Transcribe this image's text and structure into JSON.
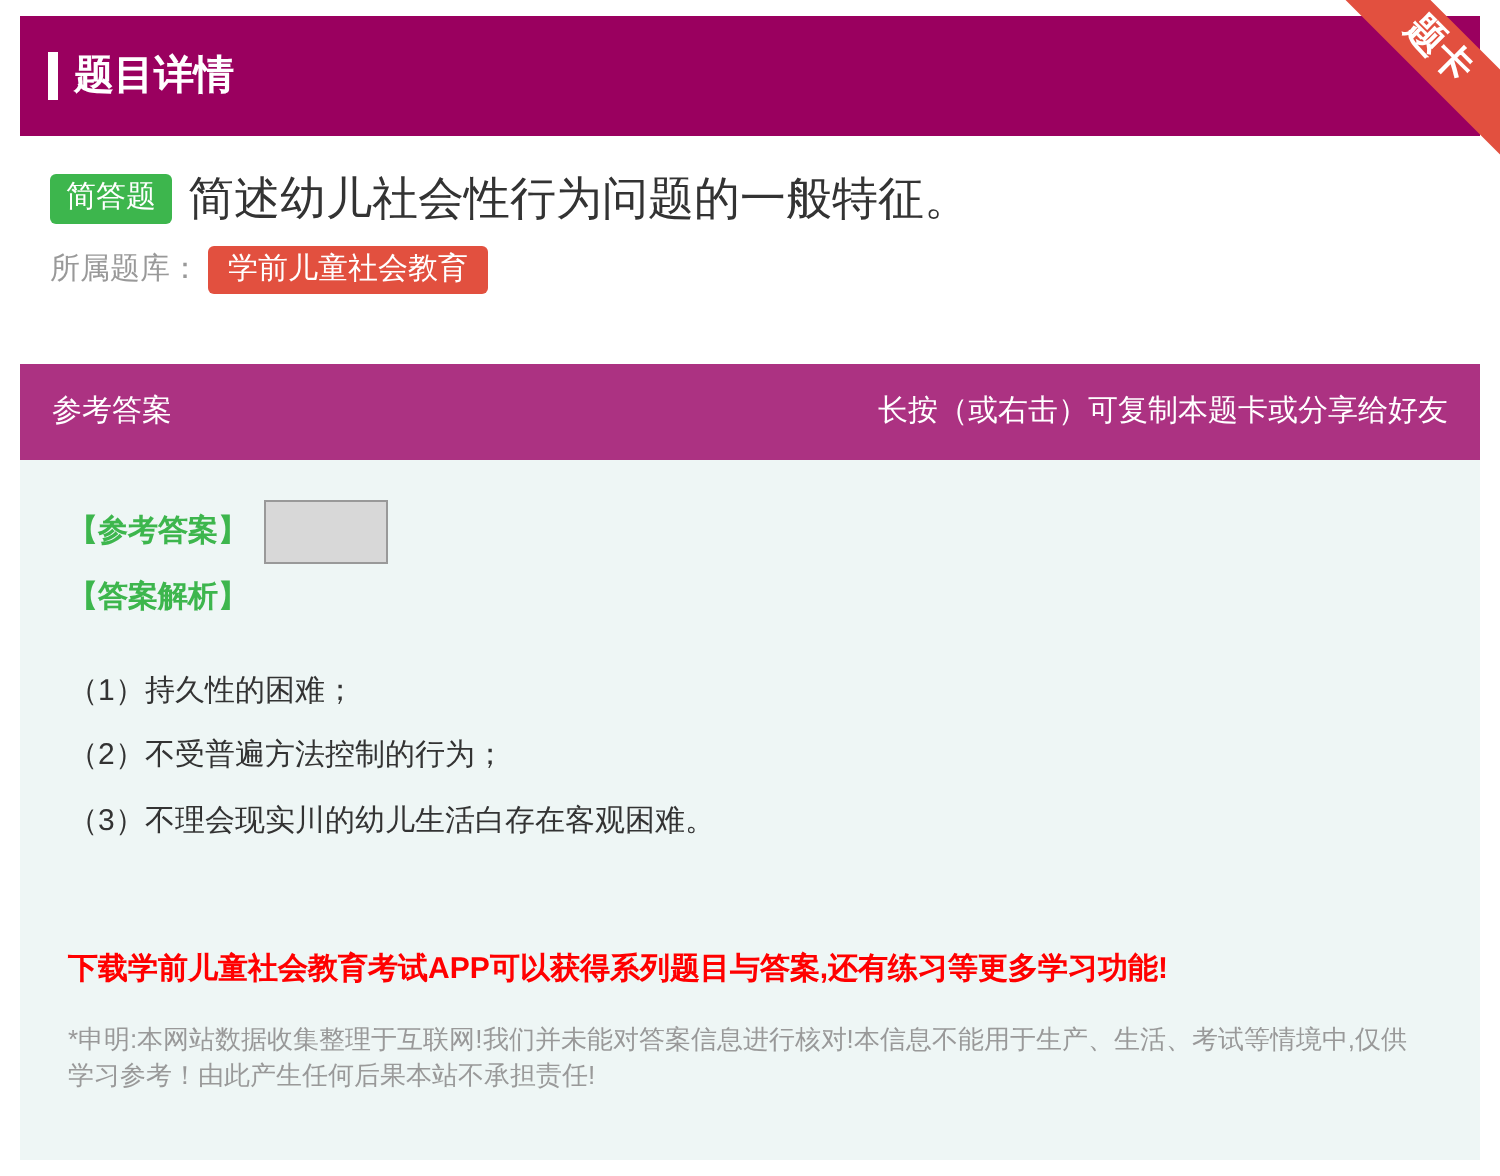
{
  "header": {
    "title": "题目详情",
    "ribbon": "题卡"
  },
  "question": {
    "type_badge": "简答题",
    "text": "简述幼儿社会性行为问题的一般特征。",
    "bank_label": "所属题库：",
    "bank": "学前儿童社会教育"
  },
  "answer_panel": {
    "title": "参考答案",
    "hint": "长按（或右击）可复制本题卡或分享给好友"
  },
  "answer": {
    "answer_label": "【参考答案】",
    "analysis_label": "【答案解析】",
    "points": [
      "（1）持久性的困难；",
      "（2）不受普遍方法控制的行为；",
      "（3）不理会现实川的幼儿生活白存在客观困难。"
    ]
  },
  "promo": "下载学前儿童社会教育考试APP可以获得系列题目与答案,还有练习等更多学习功能!",
  "disclaimer": "*申明:本网站数据收集整理于互联网!我们并未能对答案信息进行核对!本信息不能用于生产、生活、考试等情境中,仅供学习参考！由此产生任何后果本站不承担责任!"
}
